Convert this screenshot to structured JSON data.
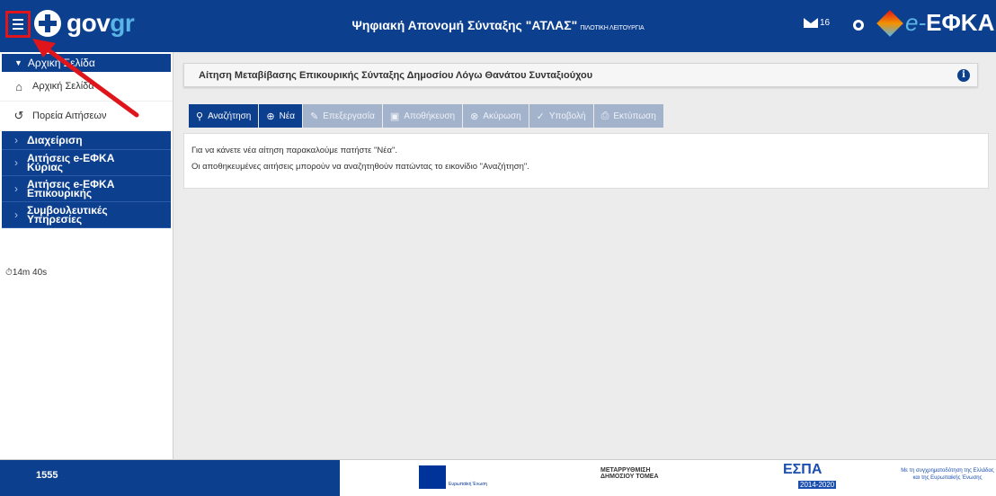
{
  "header": {
    "logo_gov": "gov",
    "logo_gr": "gr",
    "title": "Ψηφιακή Απονομή Σύνταξης \"ΑΤΛΑΣ\"",
    "pilot": "ΠΙΛΟΤΙΚΗ ΛΕΙΤΟΥΡΓΙΑ",
    "mail_count": "16",
    "efka_prefix": "e-",
    "efka_name": "ΕΦΚΑ"
  },
  "sidebar": {
    "home_header": "Αρχική Σελίδα",
    "items": [
      {
        "label": "Αρχική Σελίδα",
        "icon": "home-icon"
      },
      {
        "label": "Πορεία Αιτήσεων",
        "icon": "history-icon"
      }
    ],
    "sections": [
      {
        "label": "Διαχείριση"
      },
      {
        "label": "Αιτήσεις e-ΕΦΚΑ Κύριας"
      },
      {
        "label": "Αιτήσεις e-ΕΦΚΑ Επικουρικής"
      },
      {
        "label": "Συμβουλευτικές Υπηρεσίες"
      }
    ],
    "timer": "14m 40s"
  },
  "main": {
    "title": "Αίτηση Μεταβίβασης Επικουρικής Σύνταξης Δημοσίου Λόγω Θανάτου Συνταξιούχου",
    "toolbar": [
      {
        "label": "Αναζήτηση",
        "icon": "search-icon",
        "enabled": true
      },
      {
        "label": "Νέα",
        "icon": "plus-circle-icon",
        "enabled": true
      },
      {
        "label": "Επεξεργασία",
        "icon": "pencil-icon",
        "enabled": false
      },
      {
        "label": "Αποθήκευση",
        "icon": "save-icon",
        "enabled": false
      },
      {
        "label": "Ακύρωση",
        "icon": "cancel-icon",
        "enabled": false
      },
      {
        "label": "Υποβολή",
        "icon": "check-icon",
        "enabled": false
      },
      {
        "label": "Εκτύπωση",
        "icon": "print-icon",
        "enabled": false
      }
    ],
    "line1": "Για να κάνετε νέα αίτηση παρακαλούμε πατήστε \"Νέα\".",
    "line2": "Οι αποθηκευμένες αιτήσεις μπορούν να αναζητηθούν πατώντας το εικονίδιο \"Αναζήτηση\"."
  },
  "footer": {
    "phone": "1555",
    "eu": "Ευρωπαϊκή Ένωση",
    "metarrythmisi": "ΜΕΤΑΡΡΥΘΜΙΣΗ ΔΗΜΟΣΙΟΥ ΤΟΜΕΑ",
    "espa": "ΕΣΠΑ",
    "espa_years": "2014-2020",
    "cofinance": "Με τη συγχρηματοδότηση της Ελλάδας και της Ευρωπαϊκής Ένωσης"
  },
  "colors": {
    "primary": "#0d3f8f",
    "highlight": "#e0141b",
    "disabled": "#a4b3cc"
  }
}
